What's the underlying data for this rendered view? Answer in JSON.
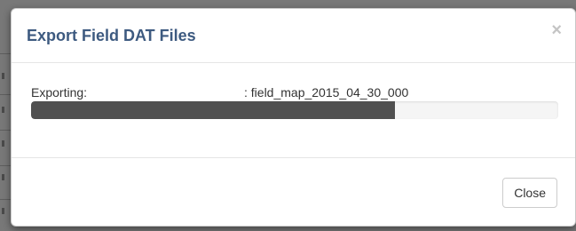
{
  "dialog": {
    "title": "Export Field DAT Files",
    "close_glyph": "×",
    "close_icon": "close-icon"
  },
  "export": {
    "label": "Exporting:",
    "file": ": field_map_2015_04_30_000",
    "progress_fraction": 0.69
  },
  "footer": {
    "close_label": "Close"
  },
  "colors": {
    "title": "#3d5a80",
    "progress_bar": "#505050",
    "progress_track": "#f5f5f5",
    "backdrop": "#787878"
  }
}
